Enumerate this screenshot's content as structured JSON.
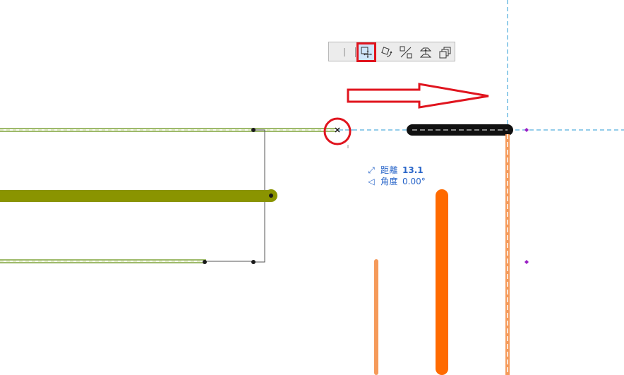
{
  "toolbar": {
    "buttons": [
      {
        "name": "line-tool-button",
        "icon": "line-icon",
        "active": false
      },
      {
        "name": "move-button",
        "icon": "move-icon",
        "active": true
      },
      {
        "name": "rotate-button",
        "icon": "rotate-icon",
        "active": false
      },
      {
        "name": "mirror-button",
        "icon": "mirror-icon",
        "active": false
      },
      {
        "name": "elevate-button",
        "icon": "elevate-icon",
        "active": false
      },
      {
        "name": "multiply-button",
        "icon": "multiply-icon",
        "active": false
      }
    ]
  },
  "readout": {
    "distance_label": "距離",
    "distance_value": "13.1",
    "angle_label": "角度",
    "angle_value": "0.00°"
  },
  "colors": {
    "wall_green": "#8a9400",
    "thin_green": "#7ea33a",
    "orange": "#ff6a00",
    "orange_light": "#f59a5a",
    "guide_blue": "#2a9bd6",
    "annotation_red": "#e0141e",
    "readout_blue": "#2a66c9",
    "marker_purple": "#9a1fc4"
  }
}
